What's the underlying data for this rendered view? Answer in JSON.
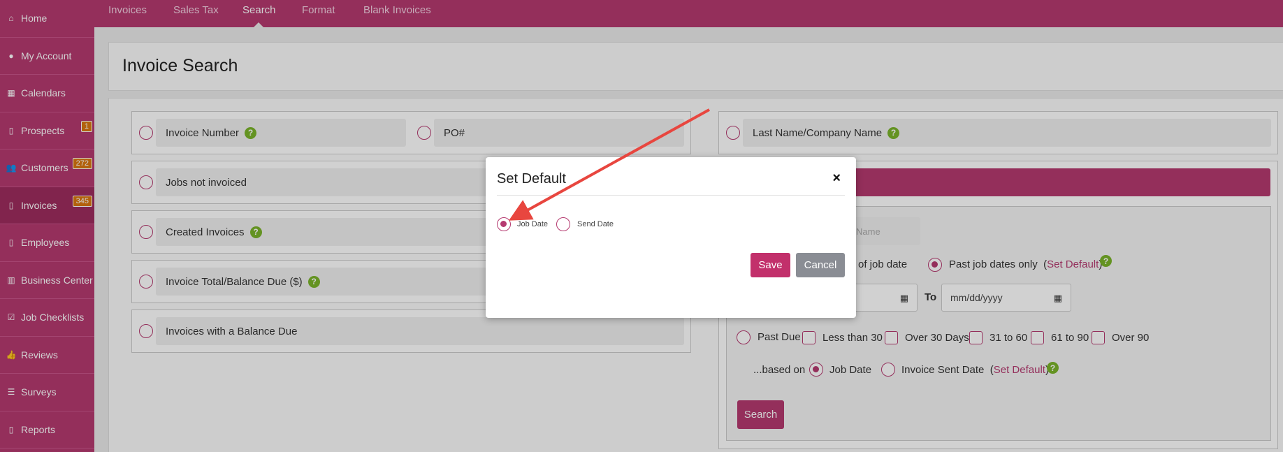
{
  "sidebar": {
    "items": [
      {
        "label": "Home",
        "icon": "home-icon",
        "glyph": "⌂"
      },
      {
        "label": "My Account",
        "icon": "account-icon",
        "glyph": "●"
      },
      {
        "label": "Calendars",
        "icon": "calendar-icon",
        "glyph": "▦"
      },
      {
        "label": "Prospects",
        "icon": "document-icon",
        "glyph": "▯",
        "badge": "1"
      },
      {
        "label": "Customers",
        "icon": "users-icon",
        "glyph": "👥",
        "badge": "272"
      },
      {
        "label": "Invoices",
        "icon": "document-icon",
        "glyph": "▯",
        "badge": "345",
        "active": true
      },
      {
        "label": "Employees",
        "icon": "document-icon",
        "glyph": "▯"
      },
      {
        "label": "Business Center",
        "icon": "building-icon",
        "glyph": "▥"
      },
      {
        "label": "Job Checklists",
        "icon": "checkbox-icon",
        "glyph": "☑"
      },
      {
        "label": "Reviews",
        "icon": "thumbs-up-icon",
        "glyph": "👍"
      },
      {
        "label": "Surveys",
        "icon": "list-icon",
        "glyph": "☰"
      },
      {
        "label": "Reports",
        "icon": "document-icon",
        "glyph": "▯"
      }
    ]
  },
  "topnav": {
    "tabs": [
      "Invoices",
      "Sales Tax",
      "Search",
      "Format",
      "Blank Invoices"
    ],
    "active": "Search"
  },
  "page": {
    "title": "Invoice Search"
  },
  "left_form": {
    "invoice_number": "Invoice Number",
    "po": "PO#",
    "jobs_not_invoiced": "Jobs not invoiced",
    "created_invoices": "Created Invoices",
    "invoice_total": "Invoice Total/Balance Due ($)",
    "balance_due": "Invoices with a Balance Due"
  },
  "right_form": {
    "last_name": "Last Name/Company Name",
    "name_placeholder": "Name",
    "of_job_date": "of job date",
    "past_job_dates": "Past job dates only",
    "set_default": "Set Default",
    "to_label": "To",
    "date_placeholder": "mm/dd/yyyy",
    "past_due": "Past Due",
    "less_than_30": "Less than 30",
    "over_30": "Over 30 Days",
    "r31_60": "31 to 60",
    "r61_90": "61 to 90",
    "over_90": "Over 90",
    "based_on": "...based on",
    "job_date": "Job Date",
    "invoice_sent_date": "Invoice Sent Date",
    "search": "Search"
  },
  "help_glyph": "?",
  "modal": {
    "title": "Set Default",
    "close_glyph": "×",
    "option_job_date": "Job Date",
    "option_send_date": "Send Date",
    "save": "Save",
    "cancel": "Cancel"
  },
  "colors": {
    "brand": "#b53a70",
    "help": "#7ab42a",
    "badge": "#d9770f",
    "arrow": "#e8463f"
  }
}
